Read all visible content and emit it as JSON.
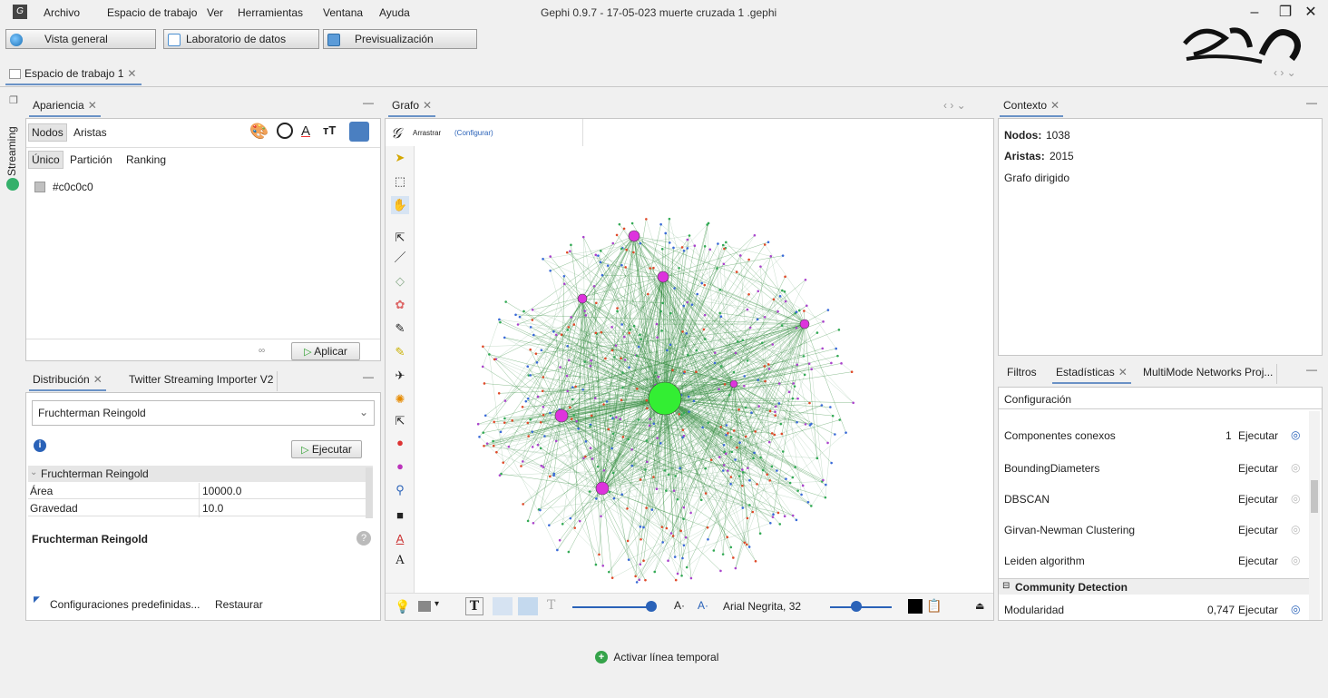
{
  "menubar": {
    "items": [
      "Archivo",
      "Espacio de trabajo",
      "Ver",
      "Herramientas",
      "Ventana",
      "Ayuda"
    ],
    "window_title": "Gephi 0.9.7 - 17-05-023 muerte cruzada 1 .gephi"
  },
  "perspectives": {
    "overview": "Vista general",
    "data_lab": "Laboratorio de datos",
    "preview": "Previsualización"
  },
  "workspace": {
    "tab": "Espacio de trabajo 1"
  },
  "appearance": {
    "tab": "Apariencia",
    "streaming_label": "Streaming",
    "target_tabs": [
      "Nodos",
      "Aristas"
    ],
    "mode_tabs": [
      "Único",
      "Partición",
      "Ranking"
    ],
    "color_value": "#c0c0c0",
    "apply_label": "Aplicar"
  },
  "layout": {
    "tabs": [
      "Distribución",
      "Twitter Streaming Importer V2"
    ],
    "algorithm": "Fruchterman Reingold",
    "execute_label": "Ejecutar",
    "section_title": "Fruchterman Reingold",
    "properties": [
      {
        "name": "Área",
        "value": "10000.0"
      },
      {
        "name": "Gravedad",
        "value": "10.0"
      }
    ],
    "description_title": "Fruchterman Reingold",
    "presets_label": "Configuraciones predefinidas...",
    "restore_label": "Restaurar"
  },
  "graph": {
    "tab": "Grafo",
    "drag_label": "Arrastrar",
    "configure_label": "(Configurar)",
    "font_label": "Arial Negrita, 32"
  },
  "context": {
    "tab": "Contexto",
    "nodes_label": "Nodos:",
    "nodes_value": "1038",
    "edges_label": "Aristas:",
    "edges_value": "2015",
    "graph_type": "Grafo dirigido"
  },
  "stats": {
    "tabs": [
      "Filtros",
      "Estadísticas",
      "MultiMode Networks Proj..."
    ],
    "config_label": "Configuración",
    "rows": [
      {
        "name": "Componentes conexos",
        "value": "1",
        "action": "Ejecutar"
      },
      {
        "name": "BoundingDiameters",
        "value": "",
        "action": "Ejecutar"
      },
      {
        "name": "DBSCAN",
        "value": "",
        "action": "Ejecutar"
      },
      {
        "name": "Girvan-Newman Clustering",
        "value": "",
        "action": "Ejecutar"
      },
      {
        "name": "Leiden algorithm",
        "value": "",
        "action": "Ejecutar"
      }
    ],
    "group_label": "Community Detection",
    "modularity": {
      "name": "Modularidad",
      "value": "0,747",
      "action": "Ejecutar"
    }
  },
  "timeline": {
    "label": "Activar línea temporal"
  }
}
